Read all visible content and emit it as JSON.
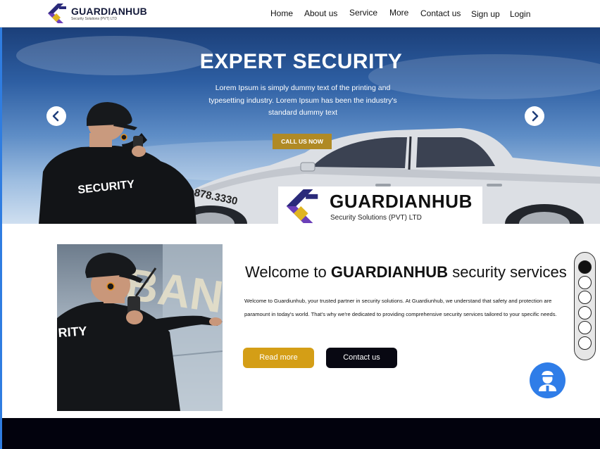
{
  "header": {
    "brand": "GUARDIANHUB",
    "brand_sub": "Security Solutions (PVT) LTD",
    "nav": [
      "Home",
      "About us",
      "Service",
      "More",
      "Contact us",
      "Sign up",
      "Login"
    ]
  },
  "hero": {
    "title": "EXPERT SECURITY",
    "text": "Lorem Ipsum is simply dummy text of the printing and typesetting industry. Lorem Ipsum has been the industry's standard dummy text",
    "cta": "CALL US NOW",
    "jacket_text": "SECURITY",
    "car_number": "878.3330",
    "plate_brand": "GUARDIANHUB",
    "plate_sub": "Security Solutions (PVT) LTD",
    "prev_icon": "chevron-left-icon",
    "next_icon": "chevron-right-icon"
  },
  "welcome": {
    "title_pre": "Welcome to ",
    "title_brand": "GUARDIANHUB",
    "title_post": " security services",
    "text": "Welcome to Guardiunhub, your trusted partner in security solutions. At Guardiunhub, we understand that safety and protection are paramount in today's world. That's why we're dedicated to providing comprehensive security services tailored to your specific needs.",
    "read_more": "Read more",
    "contact_us": "Contact us",
    "photo_text": "RITY",
    "sign_text": "BAN"
  },
  "pager": {
    "count": 6,
    "active_index": 0
  },
  "chat": {
    "icon": "security-guard-avatar-icon"
  },
  "colors": {
    "gold": "#d49e16",
    "dark": "#080812",
    "accent_blue": "#2f7de8",
    "logo_navy": "#2a2a7a",
    "logo_yellow": "#e0b521",
    "logo_purple": "#6b3fb8"
  }
}
